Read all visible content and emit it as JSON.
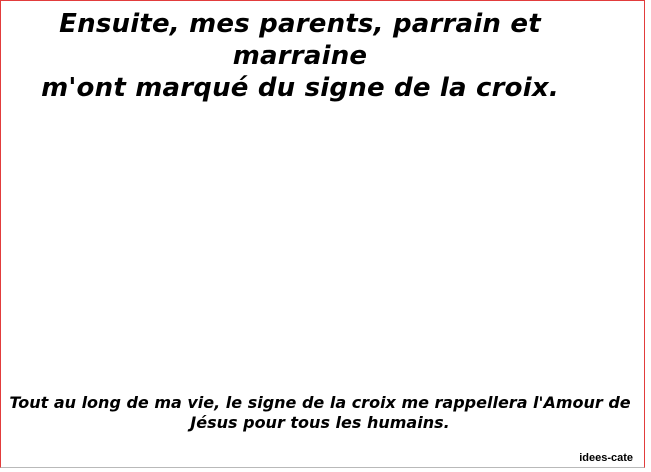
{
  "page": {
    "heading_line1": "Ensuite, mes parents, parrain et marraine",
    "heading_line2": "m'ont marqué du signe de la croix.",
    "footer_line1": "Tout au long de ma vie, le signe de la croix me rappellera l'Amour de",
    "footer_line2": "Jésus pour tous les humains.",
    "credit": "idees-cate"
  },
  "colors": {
    "frame_border": "#e23c3c",
    "text": "#000000",
    "background": "#ffffff"
  }
}
